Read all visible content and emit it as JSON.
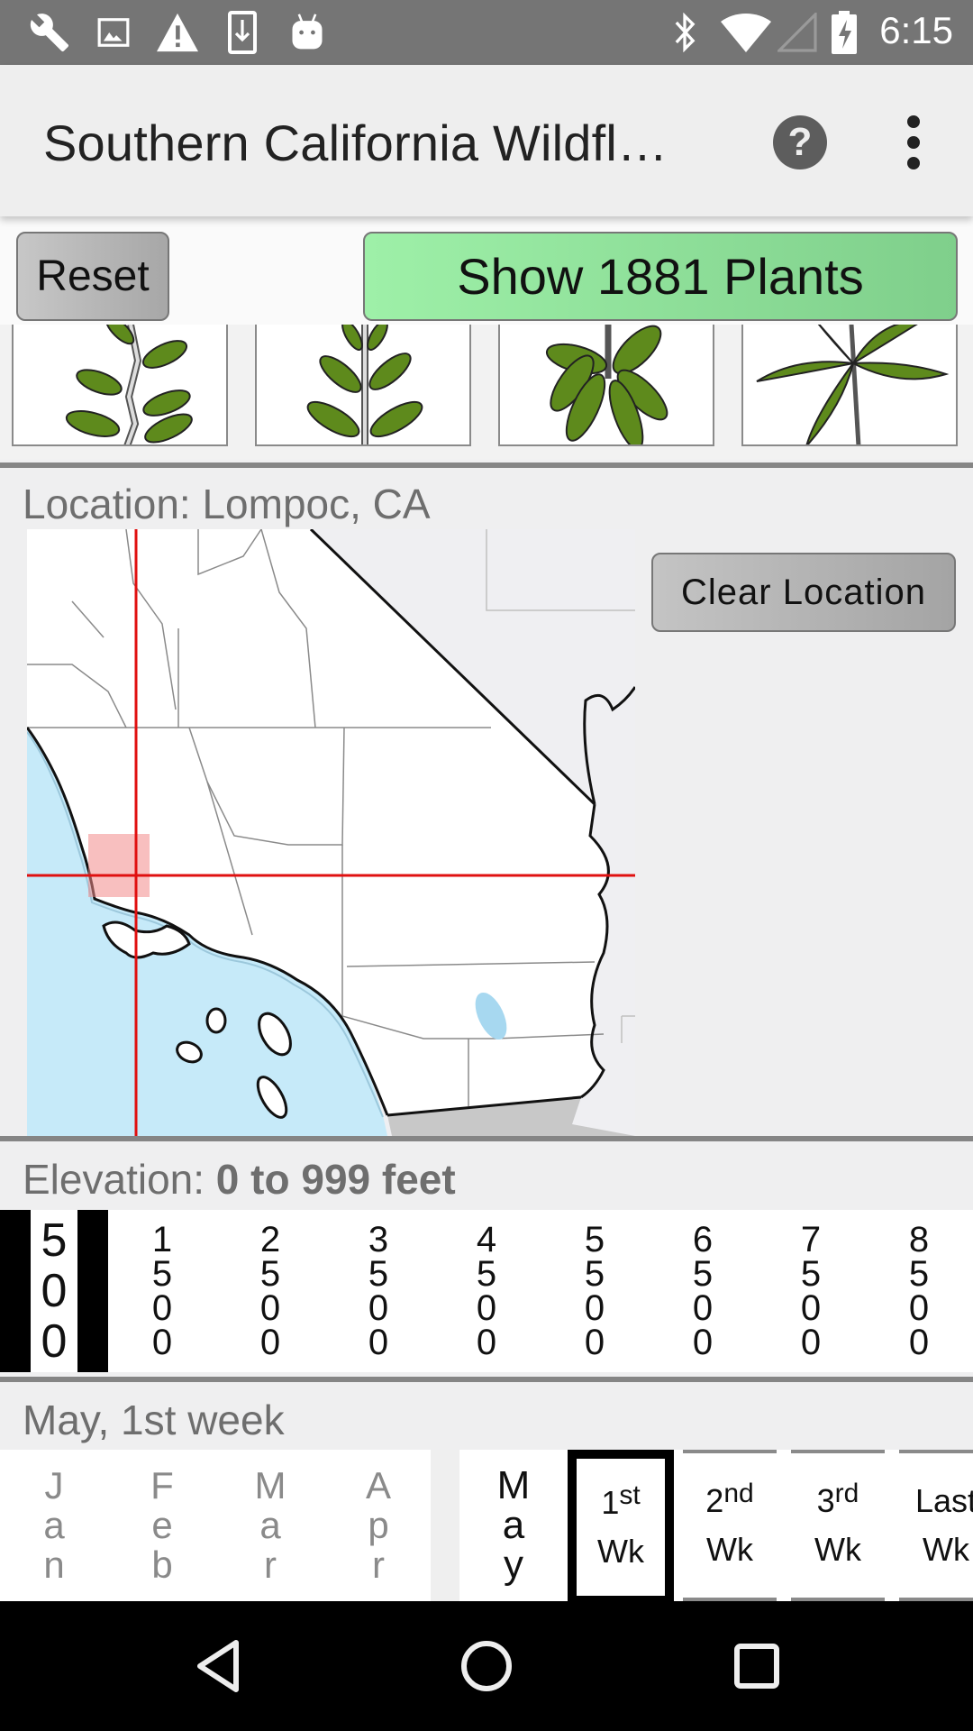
{
  "status_bar": {
    "left_icons": [
      "wrench-icon",
      "image-icon",
      "warning-icon",
      "download-icon",
      "android-icon"
    ],
    "right_icons": [
      "bluetooth-icon",
      "wifi-icon",
      "cell-signal-icon",
      "battery-charging-icon"
    ],
    "time": "6:15"
  },
  "app_bar": {
    "title": "Southern California Wildfl…",
    "help_label": "?",
    "overflow_icon": "more-vert-icon"
  },
  "actions": {
    "reset_label": "Reset",
    "show_label": "Show 1881 Plants",
    "show_color": "#8fe39b"
  },
  "leaf_types": [
    {
      "name": "alternate"
    },
    {
      "name": "opposite"
    },
    {
      "name": "whorled"
    },
    {
      "name": "palmate"
    }
  ],
  "location": {
    "label": "Location: Lompoc, CA",
    "clear_label": "Clear Location",
    "crosshair_color": "#e01010"
  },
  "elevation": {
    "label_prefix": "Elevation: ",
    "label_value": "0 to 999 feet",
    "options": [
      {
        "value": "500",
        "selected": true
      },
      {
        "value": "1500",
        "selected": false
      },
      {
        "value": "2500",
        "selected": false
      },
      {
        "value": "3500",
        "selected": false
      },
      {
        "value": "4500",
        "selected": false
      },
      {
        "value": "5500",
        "selected": false
      },
      {
        "value": "6500",
        "selected": false
      },
      {
        "value": "7500",
        "selected": false
      },
      {
        "value": "8500",
        "selected": false
      }
    ]
  },
  "season": {
    "label": "May, 1st week",
    "past_months": [
      "Jan",
      "Feb",
      "Mar",
      "Apr"
    ],
    "current_month": "May",
    "weeks": [
      {
        "num": "1",
        "suffix": "st",
        "word": "Wk",
        "selected": true
      },
      {
        "num": "2",
        "suffix": "nd",
        "word": "Wk",
        "selected": false
      },
      {
        "num": "3",
        "suffix": "rd",
        "word": "Wk",
        "selected": false
      },
      {
        "num": "Last",
        "suffix": "",
        "word": "Wk",
        "selected": false
      }
    ]
  },
  "nav_bar": {
    "back": "back-icon",
    "home": "home-icon",
    "recents": "recents-icon"
  }
}
